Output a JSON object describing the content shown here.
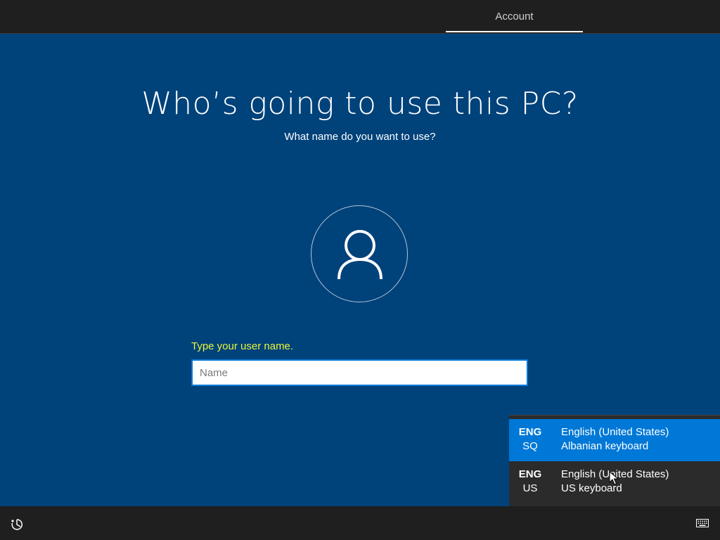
{
  "header": {
    "tab_label": "Account"
  },
  "main": {
    "title": "Who’s going to use this PC?",
    "subtitle": "What name do you want to use?",
    "avatar_icon": "user-icon",
    "prompt": "Type your user name.",
    "name_input": {
      "value": "",
      "placeholder": "Name"
    }
  },
  "language_menu": {
    "items": [
      {
        "code_top": "ENG",
        "code_bottom": "SQ",
        "language": "English (United States)",
        "keyboard": "Albanian keyboard",
        "selected": true
      },
      {
        "code_top": "ENG",
        "code_bottom": "US",
        "language": "English (United States)",
        "keyboard": "US keyboard",
        "selected": false
      }
    ]
  },
  "footer": {
    "ease_of_access_icon": "ease-of-access-icon",
    "keyboard_icon": "keyboard-icon"
  },
  "colors": {
    "background": "#00427a",
    "accent": "#0078d7",
    "prompt": "#e6f53c",
    "bars": "#1f1f1f"
  }
}
